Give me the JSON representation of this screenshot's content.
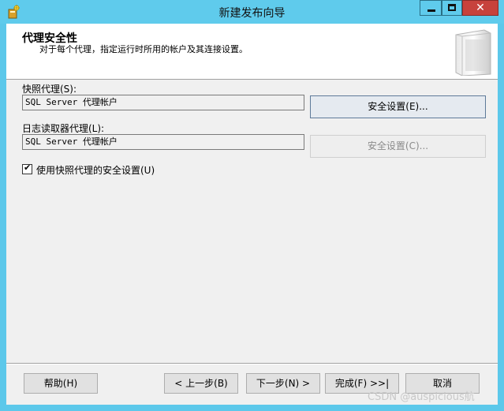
{
  "window": {
    "title": "新建发布向导",
    "close_glyph": "✕"
  },
  "header": {
    "title": "代理安全性",
    "subtitle": "对于每个代理，指定运行时所用的帐户及其连接设置。"
  },
  "snapshot_agent": {
    "label": "快照代理(S):",
    "value": "SQL Server 代理帐户",
    "button_label": "安全设置(E)..."
  },
  "log_reader_agent": {
    "label": "日志读取器代理(L):",
    "value": "SQL Server 代理帐户",
    "button_label": "安全设置(C)..."
  },
  "use_snapshot_security": {
    "label": "使用快照代理的安全设置(U)",
    "checked": true,
    "check_glyph": "✔"
  },
  "footer": {
    "help_label": "帮助(H)",
    "back_label": "< 上一步(B)",
    "next_label": "下一步(N) >",
    "finish_label": "完成(F) >>|",
    "cancel_label": "取消"
  },
  "watermark": "CSDN @auspicious航"
}
